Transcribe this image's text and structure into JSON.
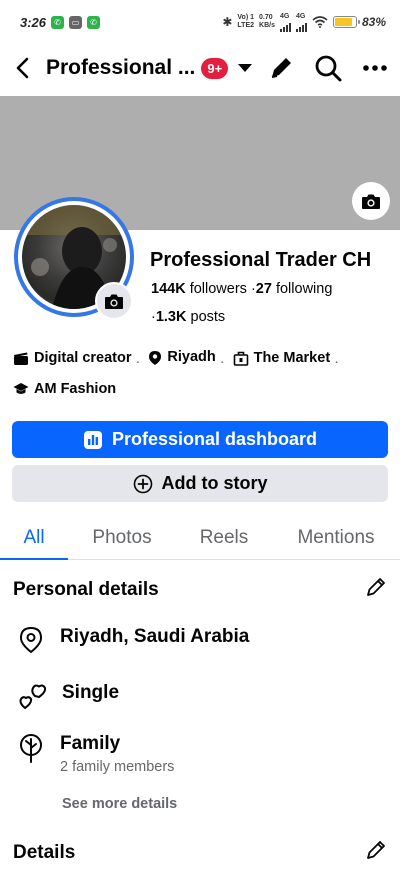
{
  "status_bar": {
    "time": "3:26",
    "net_top": "Vo) 1",
    "net_bottom": "LTE2",
    "speed_top": "0.70",
    "speed_bottom": "KB/s",
    "gen1": "4G",
    "gen2": "4G",
    "battery_level": 0.83,
    "battery_pct": "83%"
  },
  "nav": {
    "title": "Professional ...",
    "badge": "9+",
    "icons": [
      "back-arrow-icon",
      "caret-down-icon",
      "pencil-icon",
      "search-icon",
      "more-icon"
    ]
  },
  "profile": {
    "name": "Professional Trader CH",
    "followers_count": "144K",
    "followers_label": "followers",
    "sep1": "·",
    "following_count": "27",
    "following_label": "following",
    "posts_prefix": "·",
    "posts_count": "1.3K",
    "posts_label": "posts"
  },
  "info": {
    "category": "Digital creator",
    "location": "Riyadh",
    "workplace": "The Market",
    "education": "AM Fashion",
    "sep": "·"
  },
  "buttons": {
    "dashboard": "Professional dashboard",
    "add_story": "Add to story"
  },
  "tabs": [
    "All",
    "Photos",
    "Reels",
    "Mentions"
  ],
  "personal_details": {
    "title": "Personal details",
    "city": "Riyadh, Saudi Arabia",
    "relationship": "Single",
    "family_title": "Family",
    "family_sub": "2 family members",
    "see_more": "See more details"
  },
  "details": {
    "title": "Details"
  },
  "colors": {
    "accent": "#0866ff",
    "badge": "#e41e3f",
    "cover": "#aeaeae",
    "avatar_ring": "#3578e5",
    "secondary_button": "#e4e6eb",
    "muted_text": "#65676b"
  }
}
